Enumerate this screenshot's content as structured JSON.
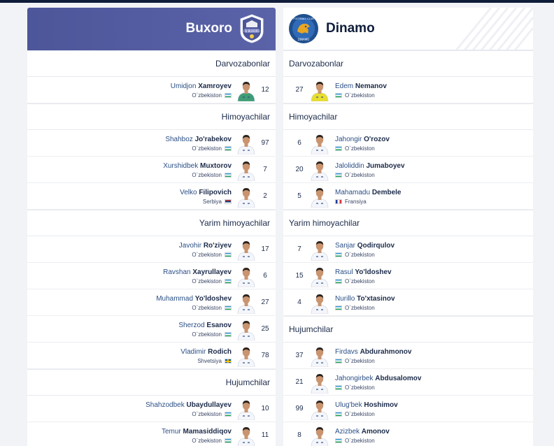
{
  "home": {
    "name": "Buxoro",
    "logo_text": "FK BUXORO",
    "sections": [
      {
        "title": "Darvozabonlar",
        "players": [
          {
            "first": "Umidjon",
            "last": "Xamroyev",
            "country": "O`zbekiston",
            "flag": "uz",
            "number": "12",
            "kit": "gk"
          }
        ]
      },
      {
        "title": "Himoyachilar",
        "players": [
          {
            "first": "Shahboz",
            "last": "Jo'rabekov",
            "country": "O`zbekiston",
            "flag": "uz",
            "number": "97",
            "kit": "field"
          },
          {
            "first": "Xurshidbek",
            "last": "Muxtorov",
            "country": "O`zbekiston",
            "flag": "uz",
            "number": "7",
            "kit": "field"
          },
          {
            "first": "Velko",
            "last": "Filipovich",
            "country": "Serbiya",
            "flag": "rs",
            "number": "2",
            "kit": "field"
          }
        ]
      },
      {
        "title": "Yarim himoyachilar",
        "players": [
          {
            "first": "Javohir",
            "last": "Ro'ziyev",
            "country": "O`zbekiston",
            "flag": "uz",
            "number": "17",
            "kit": "field"
          },
          {
            "first": "Ravshan",
            "last": "Xayrullayev",
            "country": "O`zbekiston",
            "flag": "uz",
            "number": "6",
            "kit": "field"
          },
          {
            "first": "Muhammad",
            "last": "Yo'ldoshev",
            "country": "O`zbekiston",
            "flag": "uz",
            "number": "27",
            "kit": "field"
          },
          {
            "first": "Sherzod",
            "last": "Esanov",
            "country": "O`zbekiston",
            "flag": "uz",
            "number": "25",
            "kit": "field"
          },
          {
            "first": "Vladimir",
            "last": "Rodich",
            "country": "Shvetsiya",
            "flag": "se",
            "number": "78",
            "kit": "field"
          }
        ]
      },
      {
        "title": "Hujumchilar",
        "players": [
          {
            "first": "Shahzodbek",
            "last": "Ubaydullayev",
            "country": "O`zbekiston",
            "flag": "uz",
            "number": "10",
            "kit": "field"
          },
          {
            "first": "Temur",
            "last": "Mamasiddiqov",
            "country": "O`zbekiston",
            "flag": "uz",
            "number": "11",
            "kit": "field"
          }
        ]
      }
    ]
  },
  "away": {
    "name": "Dinamo",
    "logo_text_top": "FOOTBALL CLUB",
    "logo_text_bottom": "DINAMO",
    "sections": [
      {
        "title": "Darvozabonlar",
        "players": [
          {
            "first": "Edem",
            "last": "Nemanov",
            "country": "O`zbekiston",
            "flag": "uz",
            "number": "27",
            "kit": "gk"
          }
        ]
      },
      {
        "title": "Himoyachilar",
        "players": [
          {
            "first": "Jahongir",
            "last": "O'rozov",
            "country": "O`zbekiston",
            "flag": "uz",
            "number": "6",
            "kit": "field"
          },
          {
            "first": "Jaloliddin",
            "last": "Jumaboyev",
            "country": "O`zbekiston",
            "flag": "uz",
            "number": "20",
            "kit": "field"
          },
          {
            "first": "Mahamadu",
            "last": "Dembele",
            "country": "Fransiya",
            "flag": "fr",
            "number": "5",
            "kit": "field"
          }
        ]
      },
      {
        "title": "Yarim himoyachilar",
        "players": [
          {
            "first": "Sanjar",
            "last": "Qodirqulov",
            "country": "O`zbekiston",
            "flag": "uz",
            "number": "7",
            "kit": "field"
          },
          {
            "first": "Rasul",
            "last": "Yo'ldoshev",
            "country": "O`zbekiston",
            "flag": "uz",
            "number": "15",
            "kit": "field"
          },
          {
            "first": "Nurillo",
            "last": "To'xtasinov",
            "country": "O`zbekiston",
            "flag": "uz",
            "number": "4",
            "kit": "field"
          }
        ]
      },
      {
        "title": "Hujumchilar",
        "players": [
          {
            "first": "Firdavs",
            "last": "Abdurahmonov",
            "country": "O`zbekiston",
            "flag": "uz",
            "number": "37",
            "kit": "field"
          },
          {
            "first": "Jahongirbek",
            "last": "Abdusalomov",
            "country": "O`zbekiston",
            "flag": "uz",
            "number": "21",
            "kit": "field"
          },
          {
            "first": "Ulug'bek",
            "last": "Hoshimov",
            "country": "O`zbekiston",
            "flag": "uz",
            "number": "99",
            "kit": "field"
          },
          {
            "first": "Azizbek",
            "last": "Amonov",
            "country": "O`zbekiston",
            "flag": "uz",
            "number": "8",
            "kit": "field"
          }
        ]
      }
    ]
  },
  "colors": {
    "home_header": "#5b63a8",
    "home_kit_gk": "#3f9d76",
    "away_kit_gk": "#e8de2e",
    "kit_field": "#f4f6fb",
    "skin": "#c9946f",
    "hair": "#2a211c"
  }
}
